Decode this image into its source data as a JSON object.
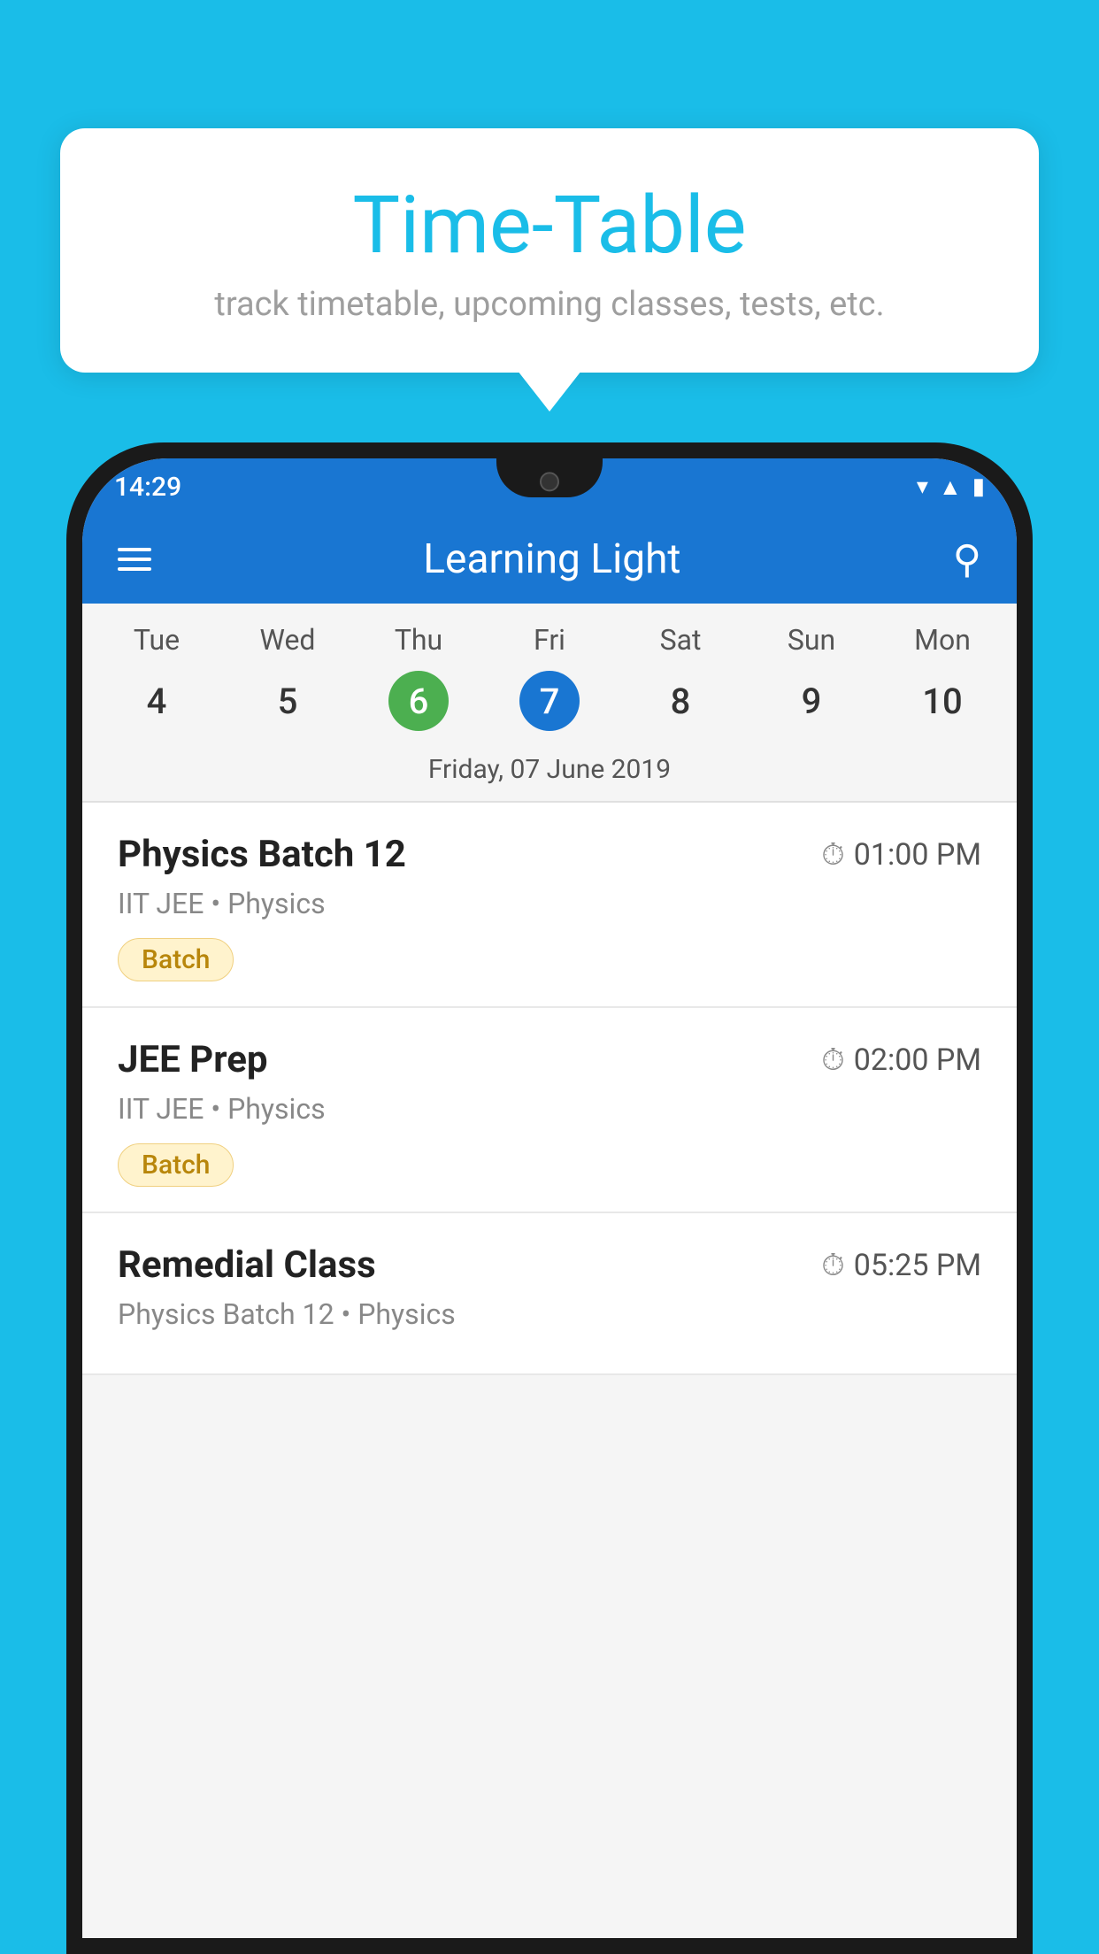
{
  "background_color": "#1ABDE8",
  "tooltip": {
    "title": "Time-Table",
    "subtitle": "track timetable, upcoming classes, tests, etc."
  },
  "status_bar": {
    "time": "14:29"
  },
  "app_header": {
    "title": "Learning Light",
    "search_label": "search"
  },
  "calendar": {
    "days": [
      "Tue",
      "Wed",
      "Thu",
      "Fri",
      "Sat",
      "Sun",
      "Mon"
    ],
    "dates": [
      "4",
      "5",
      "6",
      "7",
      "8",
      "9",
      "10"
    ],
    "today_index": 2,
    "selected_index": 3,
    "selected_date_label": "Friday, 07 June 2019"
  },
  "schedule": [
    {
      "title": "Physics Batch 12",
      "time": "01:00 PM",
      "subtitle": "IIT JEE • Physics",
      "badge": "Batch"
    },
    {
      "title": "JEE Prep",
      "time": "02:00 PM",
      "subtitle": "IIT JEE • Physics",
      "badge": "Batch"
    },
    {
      "title": "Remedial Class",
      "time": "05:25 PM",
      "subtitle": "Physics Batch 12 • Physics",
      "badge": null
    }
  ]
}
